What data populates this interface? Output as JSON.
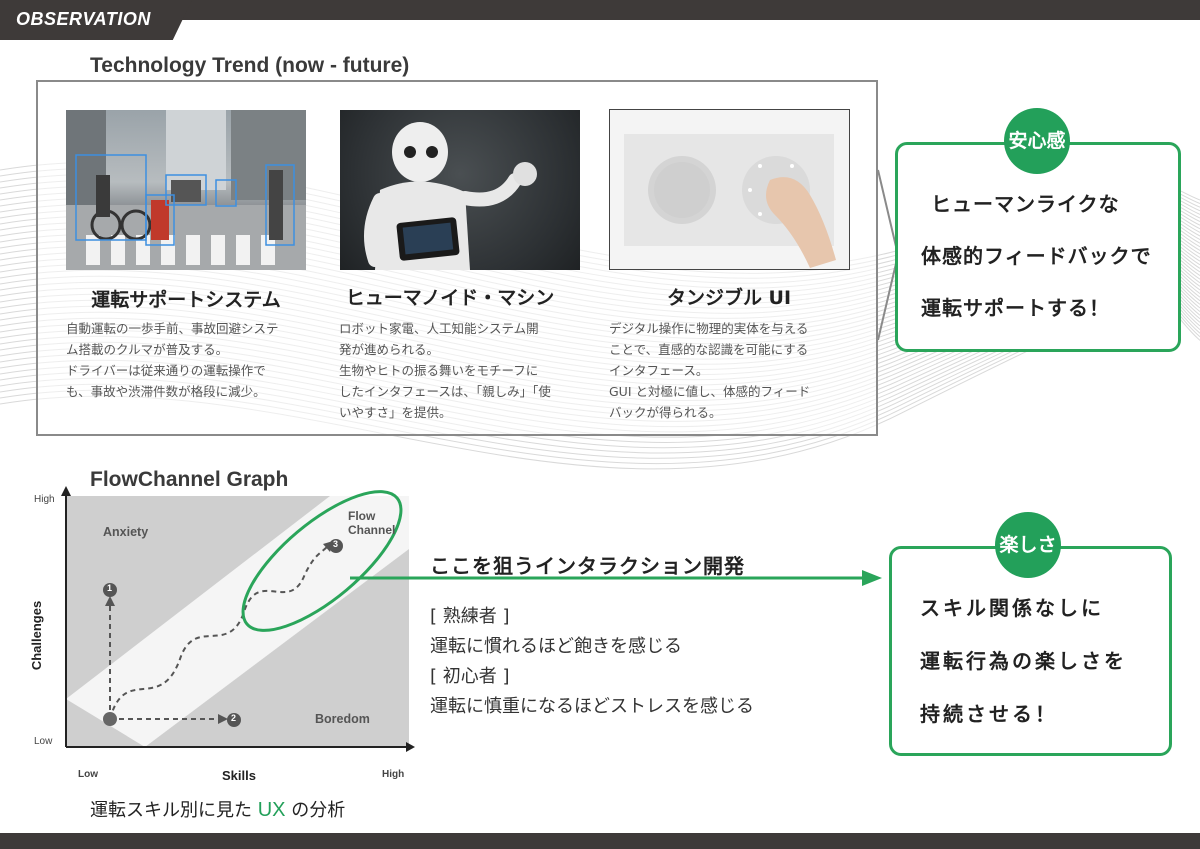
{
  "header": {
    "tag": "OBSERVATION"
  },
  "trend": {
    "title": "Technology Trend (now - future)",
    "cards": [
      {
        "title": "運転サポートシステム",
        "text": "自動運転の一歩手前、事故回避システ\nム搭載のクルマが普及する。\nドライバーは従来通りの運転操作で\nも、事故や渋滞件数が格段に減少。"
      },
      {
        "title": "ヒューマノイド・マシン",
        "text": "ロボット家電、人工知能システム開\n発が進められる。\n生物やヒトの振る舞いをモチーフに\nしたインタフェースは、「親しみ」「使\nいやすさ」を提供。"
      },
      {
        "title": "タンジブル UI",
        "text": "デジタル操作に物理的実体を与える\nことで、直感的な認識を可能にする\nインタフェース。\nGUI と対極に値し、体感的フィード\nバックが得られる。"
      }
    ]
  },
  "callout_top": {
    "badge": "安心感",
    "lines": [
      "ヒューマンライクな",
      "体感的フィードバックで",
      "運転サポートする！"
    ]
  },
  "flow": {
    "title": "FlowChannel Graph",
    "y_high": "High",
    "y_low": "Low",
    "y_axis": "Challenges",
    "x_low": "Low",
    "x_high": "High",
    "x_axis": "Skills",
    "anxiety": "Anxiety",
    "boredom": "Boredom",
    "channel_1": "Flow",
    "channel_2": "Channel",
    "p1": "1",
    "p2": "2",
    "p3": "3",
    "caption_pre": "運転スキル別に見た",
    "caption_ux": "UX",
    "caption_post": "の分析"
  },
  "middle": {
    "heading": "ここを狙うインタラクション開発",
    "lines": [
      "[ 熟練者 ]",
      "運転に慣れるほど飽きを感じる",
      "[ 初心者 ]",
      "運転に慎重になるほどストレスを感じる"
    ]
  },
  "callout_bottom": {
    "badge": "楽しさ",
    "lines": [
      "スキル関係なしに",
      "運転行為の楽しさを",
      "持続させる！"
    ]
  },
  "colors": {
    "accent": "#23a05a",
    "dark": "#3e3a39",
    "ux": "#23a05a"
  }
}
